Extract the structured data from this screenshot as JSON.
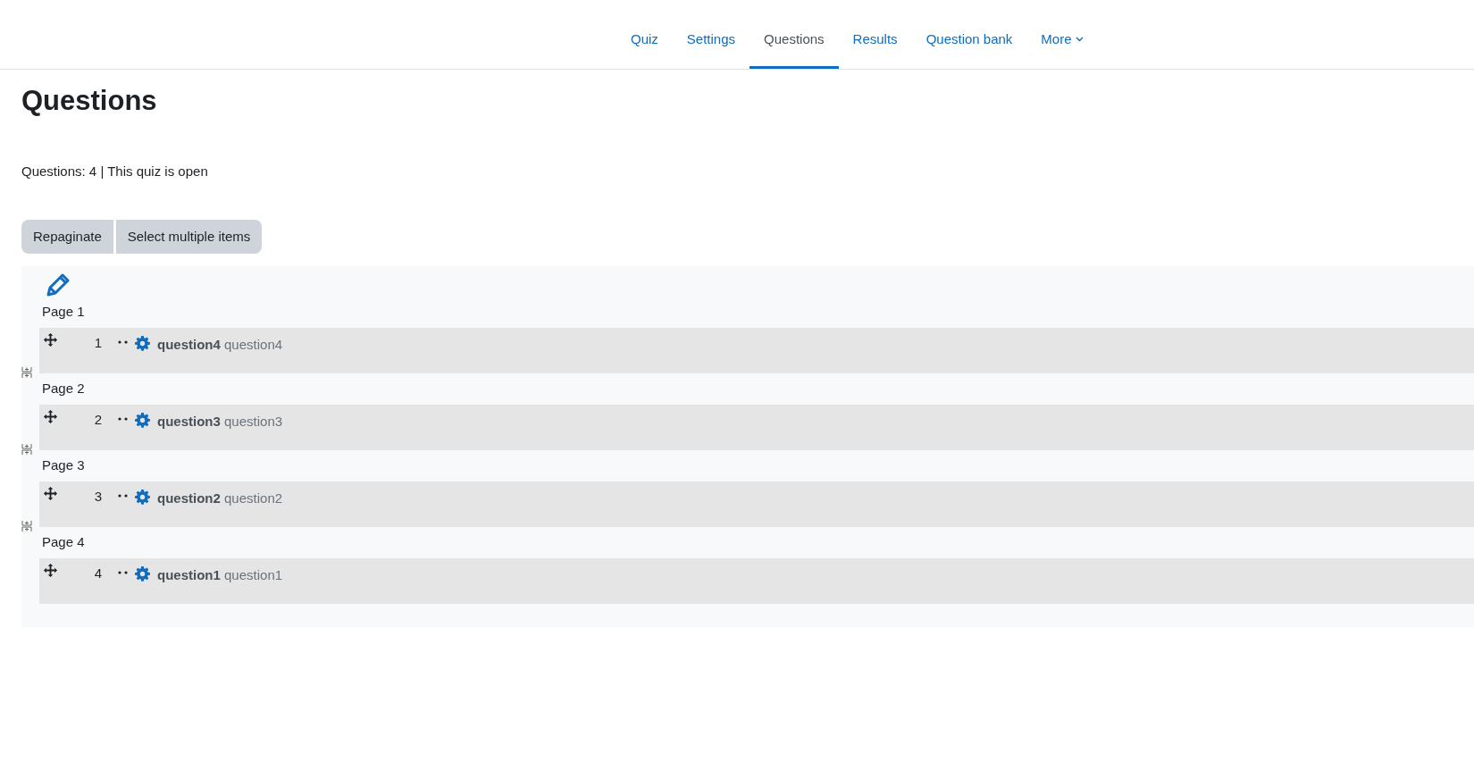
{
  "nav_tabs": [
    {
      "label": "Quiz",
      "selected": false,
      "kind": "link"
    },
    {
      "label": "Settings",
      "selected": false,
      "kind": "link"
    },
    {
      "label": "Questions",
      "selected": true,
      "kind": "link"
    },
    {
      "label": "Results",
      "selected": false,
      "kind": "link"
    },
    {
      "label": "Question bank",
      "selected": false,
      "kind": "link"
    },
    {
      "label": "More",
      "selected": false,
      "kind": "dropdown"
    }
  ],
  "heading": "Questions",
  "summary": "Questions: 4 | This quiz is open",
  "buttons": [
    "Repaginate",
    "Select multiple items"
  ],
  "pages": [
    {
      "label": "Page 1",
      "slot": {
        "number": "1",
        "name": "question4",
        "text": "question4"
      }
    },
    {
      "label": "Page 2",
      "slot": {
        "number": "2",
        "name": "question3",
        "text": "question3"
      }
    },
    {
      "label": "Page 3",
      "slot": {
        "number": "3",
        "name": "question2",
        "text": "question2"
      }
    },
    {
      "label": "Page 4",
      "slot": {
        "number": "4",
        "name": "question1",
        "text": "question1"
      }
    }
  ]
}
